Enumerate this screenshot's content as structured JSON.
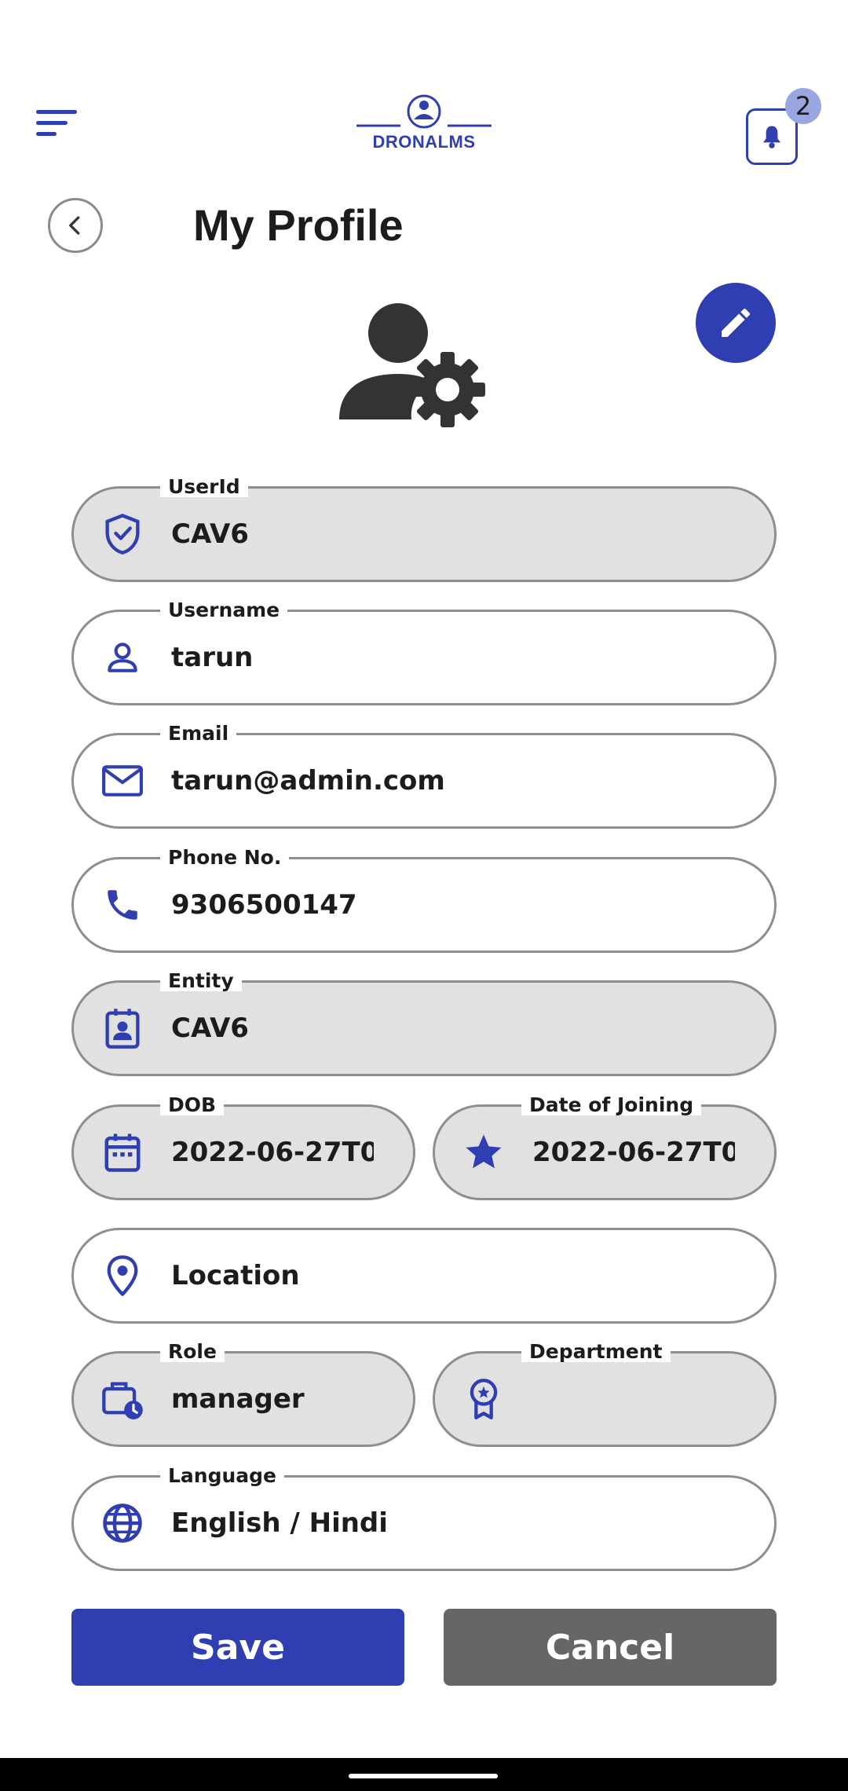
{
  "header": {
    "logo_text": "DRONALMS",
    "notification_count": "2"
  },
  "page": {
    "title": "My Profile"
  },
  "colors": {
    "accent": "#2f3eb1",
    "disabled_bg": "#e1e1e1",
    "cancel_bg": "#666666",
    "badge_bg": "#9aa6e0"
  },
  "fields": {
    "userid": {
      "label": "UserId",
      "value": "CAV6",
      "icon": "shield-check-icon"
    },
    "username": {
      "label": "Username",
      "value": "tarun",
      "icon": "person-icon"
    },
    "email": {
      "label": "Email",
      "value": "tarun@admin.com",
      "icon": "mail-icon"
    },
    "phone": {
      "label": "Phone No.",
      "value": "9306500147",
      "icon": "phone-icon"
    },
    "entity": {
      "label": "Entity",
      "value": "CAV6",
      "icon": "badge-icon"
    },
    "dob": {
      "label": "DOB",
      "value": "2022-06-27T0",
      "icon": "calendar-icon"
    },
    "doj": {
      "label": "Date of Joining",
      "value": "2022-06-27T0",
      "icon": "star-icon"
    },
    "location": {
      "placeholder": "Location",
      "icon": "location-pin-icon"
    },
    "role": {
      "label": "Role",
      "value": "manager",
      "icon": "briefcase-clock-icon"
    },
    "department": {
      "label": "Department",
      "value": "",
      "icon": "award-icon"
    },
    "language": {
      "label": "Language",
      "value": "English / Hindi",
      "icon": "globe-icon"
    }
  },
  "actions": {
    "save_label": "Save",
    "cancel_label": "Cancel"
  }
}
